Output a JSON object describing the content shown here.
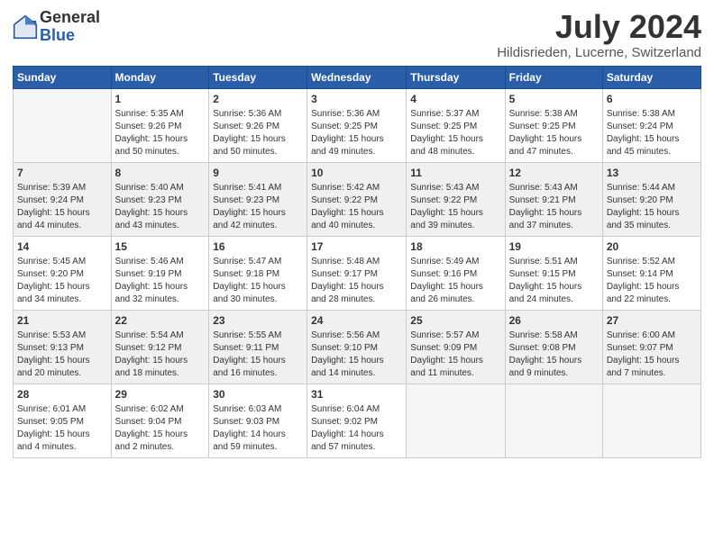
{
  "logo": {
    "general": "General",
    "blue": "Blue"
  },
  "title": {
    "month_year": "July 2024",
    "location": "Hildisrieden, Lucerne, Switzerland"
  },
  "weekdays": [
    "Sunday",
    "Monday",
    "Tuesday",
    "Wednesday",
    "Thursday",
    "Friday",
    "Saturday"
  ],
  "weeks": [
    [
      {
        "day": "",
        "info": ""
      },
      {
        "day": "1",
        "info": "Sunrise: 5:35 AM\nSunset: 9:26 PM\nDaylight: 15 hours\nand 50 minutes."
      },
      {
        "day": "2",
        "info": "Sunrise: 5:36 AM\nSunset: 9:26 PM\nDaylight: 15 hours\nand 50 minutes."
      },
      {
        "day": "3",
        "info": "Sunrise: 5:36 AM\nSunset: 9:25 PM\nDaylight: 15 hours\nand 49 minutes."
      },
      {
        "day": "4",
        "info": "Sunrise: 5:37 AM\nSunset: 9:25 PM\nDaylight: 15 hours\nand 48 minutes."
      },
      {
        "day": "5",
        "info": "Sunrise: 5:38 AM\nSunset: 9:25 PM\nDaylight: 15 hours\nand 47 minutes."
      },
      {
        "day": "6",
        "info": "Sunrise: 5:38 AM\nSunset: 9:24 PM\nDaylight: 15 hours\nand 45 minutes."
      }
    ],
    [
      {
        "day": "7",
        "info": "Sunrise: 5:39 AM\nSunset: 9:24 PM\nDaylight: 15 hours\nand 44 minutes."
      },
      {
        "day": "8",
        "info": "Sunrise: 5:40 AM\nSunset: 9:23 PM\nDaylight: 15 hours\nand 43 minutes."
      },
      {
        "day": "9",
        "info": "Sunrise: 5:41 AM\nSunset: 9:23 PM\nDaylight: 15 hours\nand 42 minutes."
      },
      {
        "day": "10",
        "info": "Sunrise: 5:42 AM\nSunset: 9:22 PM\nDaylight: 15 hours\nand 40 minutes."
      },
      {
        "day": "11",
        "info": "Sunrise: 5:43 AM\nSunset: 9:22 PM\nDaylight: 15 hours\nand 39 minutes."
      },
      {
        "day": "12",
        "info": "Sunrise: 5:43 AM\nSunset: 9:21 PM\nDaylight: 15 hours\nand 37 minutes."
      },
      {
        "day": "13",
        "info": "Sunrise: 5:44 AM\nSunset: 9:20 PM\nDaylight: 15 hours\nand 35 minutes."
      }
    ],
    [
      {
        "day": "14",
        "info": "Sunrise: 5:45 AM\nSunset: 9:20 PM\nDaylight: 15 hours\nand 34 minutes."
      },
      {
        "day": "15",
        "info": "Sunrise: 5:46 AM\nSunset: 9:19 PM\nDaylight: 15 hours\nand 32 minutes."
      },
      {
        "day": "16",
        "info": "Sunrise: 5:47 AM\nSunset: 9:18 PM\nDaylight: 15 hours\nand 30 minutes."
      },
      {
        "day": "17",
        "info": "Sunrise: 5:48 AM\nSunset: 9:17 PM\nDaylight: 15 hours\nand 28 minutes."
      },
      {
        "day": "18",
        "info": "Sunrise: 5:49 AM\nSunset: 9:16 PM\nDaylight: 15 hours\nand 26 minutes."
      },
      {
        "day": "19",
        "info": "Sunrise: 5:51 AM\nSunset: 9:15 PM\nDaylight: 15 hours\nand 24 minutes."
      },
      {
        "day": "20",
        "info": "Sunrise: 5:52 AM\nSunset: 9:14 PM\nDaylight: 15 hours\nand 22 minutes."
      }
    ],
    [
      {
        "day": "21",
        "info": "Sunrise: 5:53 AM\nSunset: 9:13 PM\nDaylight: 15 hours\nand 20 minutes."
      },
      {
        "day": "22",
        "info": "Sunrise: 5:54 AM\nSunset: 9:12 PM\nDaylight: 15 hours\nand 18 minutes."
      },
      {
        "day": "23",
        "info": "Sunrise: 5:55 AM\nSunset: 9:11 PM\nDaylight: 15 hours\nand 16 minutes."
      },
      {
        "day": "24",
        "info": "Sunrise: 5:56 AM\nSunset: 9:10 PM\nDaylight: 15 hours\nand 14 minutes."
      },
      {
        "day": "25",
        "info": "Sunrise: 5:57 AM\nSunset: 9:09 PM\nDaylight: 15 hours\nand 11 minutes."
      },
      {
        "day": "26",
        "info": "Sunrise: 5:58 AM\nSunset: 9:08 PM\nDaylight: 15 hours\nand 9 minutes."
      },
      {
        "day": "27",
        "info": "Sunrise: 6:00 AM\nSunset: 9:07 PM\nDaylight: 15 hours\nand 7 minutes."
      }
    ],
    [
      {
        "day": "28",
        "info": "Sunrise: 6:01 AM\nSunset: 9:05 PM\nDaylight: 15 hours\nand 4 minutes."
      },
      {
        "day": "29",
        "info": "Sunrise: 6:02 AM\nSunset: 9:04 PM\nDaylight: 15 hours\nand 2 minutes."
      },
      {
        "day": "30",
        "info": "Sunrise: 6:03 AM\nSunset: 9:03 PM\nDaylight: 14 hours\nand 59 minutes."
      },
      {
        "day": "31",
        "info": "Sunrise: 6:04 AM\nSunset: 9:02 PM\nDaylight: 14 hours\nand 57 minutes."
      },
      {
        "day": "",
        "info": ""
      },
      {
        "day": "",
        "info": ""
      },
      {
        "day": "",
        "info": ""
      }
    ]
  ]
}
